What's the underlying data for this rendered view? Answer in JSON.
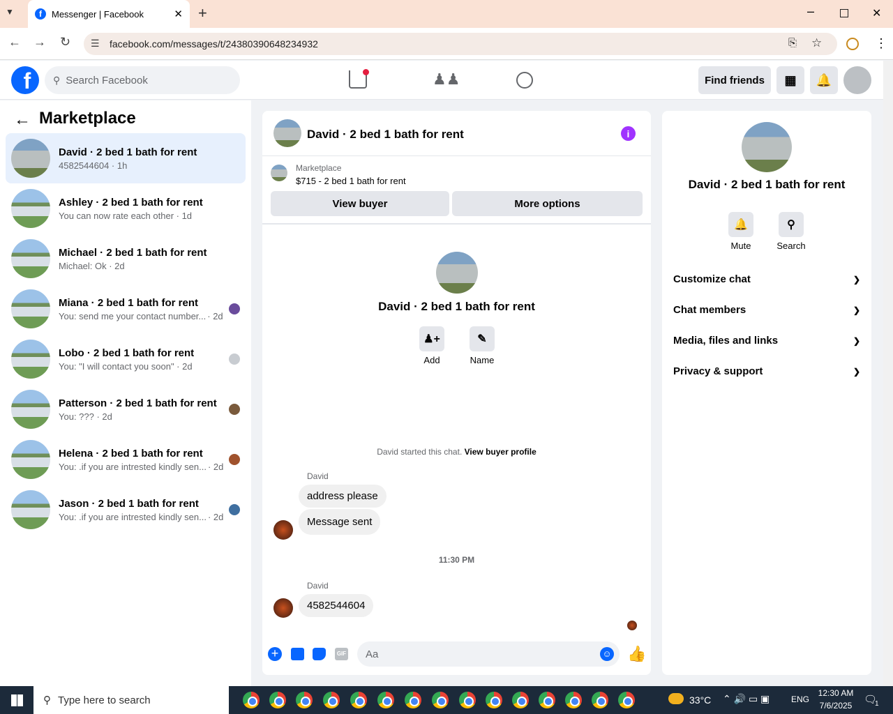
{
  "browser": {
    "tab_title": "Messenger | Facebook",
    "url": "facebook.com/messages/t/24380390648234932"
  },
  "fb": {
    "search_placeholder": "Search Facebook",
    "find_friends": "Find friends"
  },
  "left": {
    "title": "Marketplace",
    "conversations": [
      {
        "name": "David · 2 bed 1 bath for rent",
        "preview": "4582544604 · 1h"
      },
      {
        "name": "Ashley · 2 bed 1 bath for rent",
        "preview": "You can now rate each other · 1d"
      },
      {
        "name": "Michael · 2 bed 1 bath for rent",
        "preview": "Michael: Ok · 2d"
      },
      {
        "name": "Miana · 2 bed 1 bath for rent",
        "preview": "You: send me your contact number...",
        "time": "· 2d"
      },
      {
        "name": "Lobo · 2 bed 1 bath for rent",
        "preview": "You: \"I will contact you soon\" · 2d"
      },
      {
        "name": "Patterson · 2 bed 1 bath for rent",
        "preview": "You: ??? · 2d"
      },
      {
        "name": "Helena · 2 bed 1 bath for rent",
        "preview": "You: .if you are intrested kindly sen...",
        "time": "· 2d"
      },
      {
        "name": "Jason · 2 bed 1 bath for rent",
        "preview": "You: .if you are intrested kindly sen...",
        "time": "· 2d"
      }
    ]
  },
  "chat": {
    "header": "David · 2 bed 1 bath for rent",
    "listing_label": "Marketplace",
    "listing_title": "$715 - 2 bed 1 bath for rent",
    "view_buyer": "View buyer",
    "more_options": "More options",
    "profile_name": "David · 2 bed 1 bath for rent",
    "add_label": "Add",
    "name_label": "Name",
    "started": "David started this chat.",
    "view_buyer_profile": "View buyer profile",
    "sender1": "David",
    "msg1": "address please",
    "msg2": "Message sent",
    "time_divider": "11:30 PM",
    "sender2": "David",
    "msg3": "4582544604",
    "composer_placeholder": "Aa"
  },
  "right": {
    "name": "David · 2 bed 1 bath for rent",
    "mute": "Mute",
    "search": "Search",
    "sections": [
      "Customize chat",
      "Chat members",
      "Media, files and links",
      "Privacy & support"
    ]
  },
  "taskbar": {
    "search": "Type here to search",
    "temp": "33°C",
    "lang": "ENG",
    "time": "12:30 AM",
    "date": "7/6/2025",
    "notif": "1"
  },
  "colors": {
    "fb_blue": "#0866ff",
    "purple": "#a033ff"
  }
}
